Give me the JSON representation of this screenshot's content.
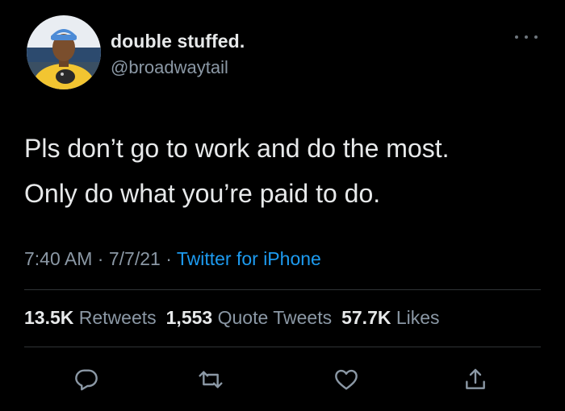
{
  "user": {
    "display_name": "double stuffed.",
    "handle": "@broadwaytail",
    "avatar_icon": "profile-photo"
  },
  "tweet": {
    "lines": [
      "Pls don’t go to work and do the most.",
      "Only do what you’re paid to do."
    ]
  },
  "meta": {
    "time": "7:40 AM",
    "separator": "·",
    "date": "7/7/21",
    "source": "Twitter for iPhone"
  },
  "stats": {
    "retweets_count": "13.5K",
    "retweets_label": "Retweets",
    "quote_count": "1,553",
    "quote_label": "Quote Tweets",
    "likes_count": "57.7K",
    "likes_label": "Likes"
  },
  "actions": [
    "reply-icon",
    "retweet-icon",
    "like-icon",
    "share-icon"
  ],
  "colors": {
    "background": "#000000",
    "primary_text": "#e7e9ea",
    "secondary_text": "#8b98a5",
    "link": "#1d9bf0",
    "divider": "#2f3336"
  }
}
